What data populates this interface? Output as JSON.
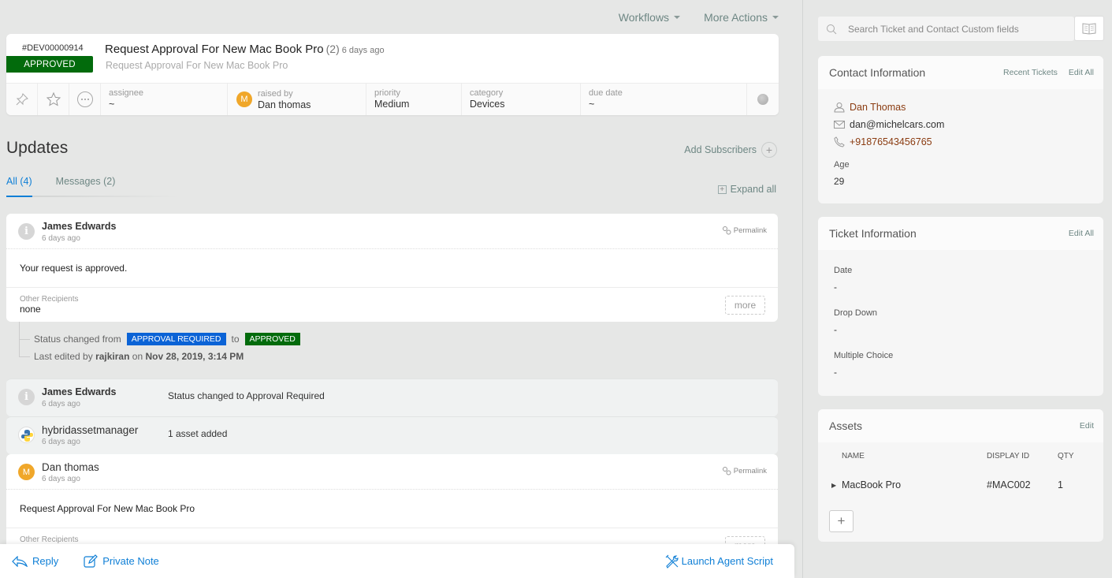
{
  "top_actions": {
    "workflows": "Workflows",
    "more_actions": "More Actions"
  },
  "ticket": {
    "id": "#DEV00000914",
    "status": "APPROVED",
    "status_color": "#026b0c",
    "title": "Request Approval For New Mac Book Pro",
    "count": "(2)",
    "age": "6 days ago",
    "subtitle": "Request Approval For New Mac Book Pro",
    "fields": {
      "assignee": {
        "label": "assignee",
        "value": "~"
      },
      "raised_by": {
        "label": "raised by",
        "value": "Dan thomas",
        "avatar": "M"
      },
      "priority": {
        "label": "priority",
        "value": "Medium"
      },
      "category": {
        "label": "category",
        "value": "Devices"
      },
      "due_date": {
        "label": "due date",
        "value": "~"
      }
    }
  },
  "updates": {
    "title": "Updates",
    "add_subscribers": "Add Subscribers",
    "tabs": [
      {
        "label": "All (4)",
        "active": true
      },
      {
        "label": "Messages (2)",
        "active": false
      }
    ],
    "expand_all": "Expand all",
    "items": [
      {
        "author": "James Edwards",
        "time": "6 days ago",
        "permalink": "Permalink",
        "body": "Your request is approved.",
        "recipients_label": "Other Recipients",
        "recipients": "none",
        "more": "more"
      },
      {
        "author": "James Edwards",
        "time": "6 days ago",
        "description": "Status changed to Approval Required"
      },
      {
        "author": "hybridassetmanager",
        "time": "6 days ago",
        "description": "1 asset added"
      },
      {
        "author": "Dan thomas",
        "time": "6 days ago",
        "permalink": "Permalink",
        "avatar": "M",
        "body": "Request Approval For New Mac Book Pro",
        "recipients_label": "Other Recipients",
        "more": "more"
      }
    ],
    "history": {
      "status_changed_from": "Status changed from",
      "from_status": "APPROVAL REQUIRED",
      "to_word": "to",
      "to_status": "APPROVED",
      "last_edited_by": "Last edited by",
      "editor": "rajkiran",
      "on_word": "on",
      "edited_at": "Nov 28, 2019, 3:14 PM"
    }
  },
  "bottom_bar": {
    "reply": "Reply",
    "private_note": "Private Note",
    "launch_agent_script": "Launch Agent Script"
  },
  "sidebar": {
    "search_placeholder": "Search Ticket and Contact Custom fields",
    "contact": {
      "title": "Contact Information",
      "recent_tickets": "Recent Tickets",
      "edit_all": "Edit All",
      "name": "Dan Thomas",
      "email": "dan@michelcars.com",
      "phone": "+91876543456765",
      "age_label": "Age",
      "age_value": "29"
    },
    "ticket_info": {
      "title": "Ticket Information",
      "edit_all": "Edit All",
      "fields": [
        {
          "label": "Date",
          "value": "-"
        },
        {
          "label": "Drop Down",
          "value": "-"
        },
        {
          "label": "Multiple Choice",
          "value": "-"
        }
      ]
    },
    "assets": {
      "title": "Assets",
      "edit": "Edit",
      "columns": [
        "NAME",
        "DISPLAY ID",
        "QTY"
      ],
      "rows": [
        {
          "name": "MacBook Pro",
          "display_id": "#MAC002",
          "qty": "1"
        }
      ],
      "add_label": "+"
    }
  }
}
